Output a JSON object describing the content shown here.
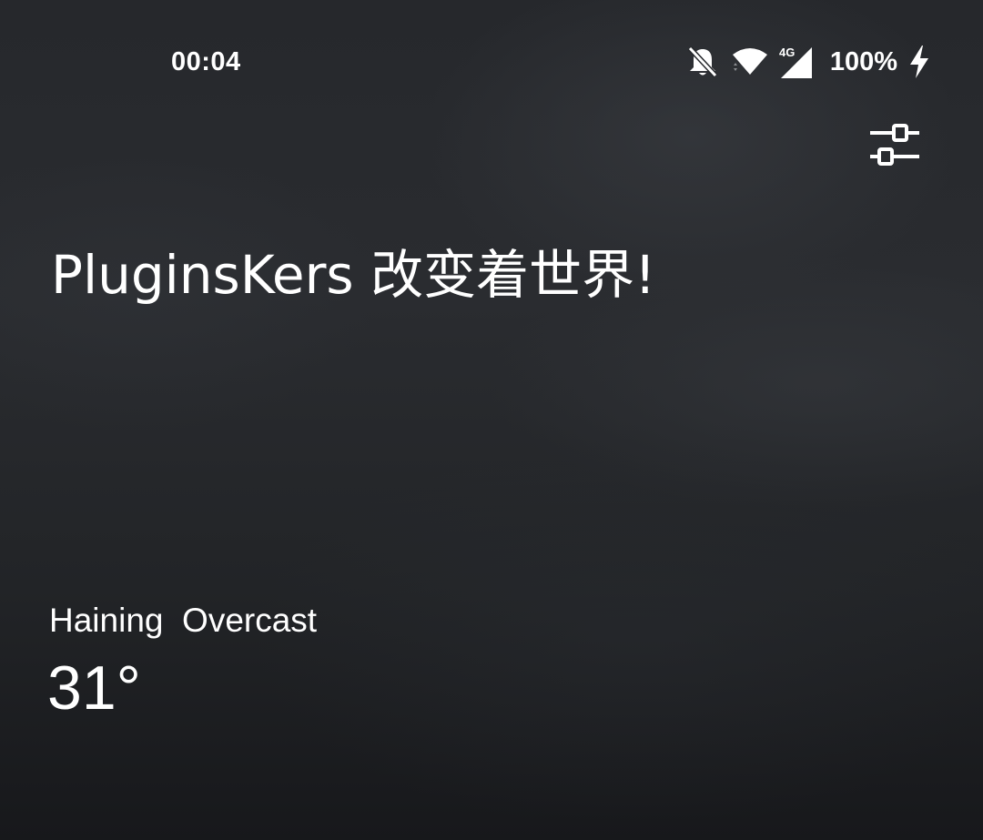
{
  "status_bar": {
    "time": "00:04",
    "icons": [
      "bell-off-icon",
      "wifi-icon",
      "signal-4g-icon",
      "charging-icon"
    ],
    "network_type": "4G",
    "battery": "100%"
  },
  "toolbar": {
    "settings_icon": "tune-icon"
  },
  "greeting": {
    "text": "PluginsKers 改变着世界!"
  },
  "weather": {
    "city": "Haining",
    "condition": "Overcast",
    "temperature": "31°"
  }
}
